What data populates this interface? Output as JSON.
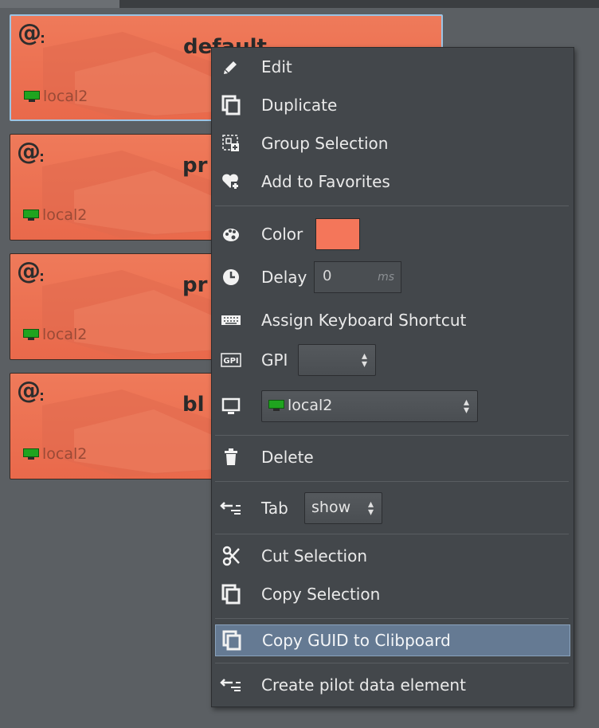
{
  "cards": [
    {
      "name": "default",
      "host": "local2"
    },
    {
      "name": "pr",
      "host": "local2"
    },
    {
      "name": "pr",
      "host": "local2"
    },
    {
      "name": "bl",
      "host": "local2"
    }
  ],
  "menu": {
    "edit": "Edit",
    "duplicate": "Duplicate",
    "group_selection": "Group Selection",
    "add_to_favorites": "Add to Favorites",
    "color": "Color",
    "color_value": "#f4765a",
    "delay": "Delay",
    "delay_value": "0",
    "delay_unit": "ms",
    "assign_shortcut": "Assign Keyboard Shortcut",
    "gpi": "GPI",
    "gpi_value": "",
    "output_value": "local2",
    "delete": "Delete",
    "tab": "Tab",
    "tab_value": "show",
    "cut_selection": "Cut Selection",
    "copy_selection": "Copy Selection",
    "copy_guid": "Copy GUID to Clibpoard",
    "create_pilot": "Create pilot data element"
  }
}
